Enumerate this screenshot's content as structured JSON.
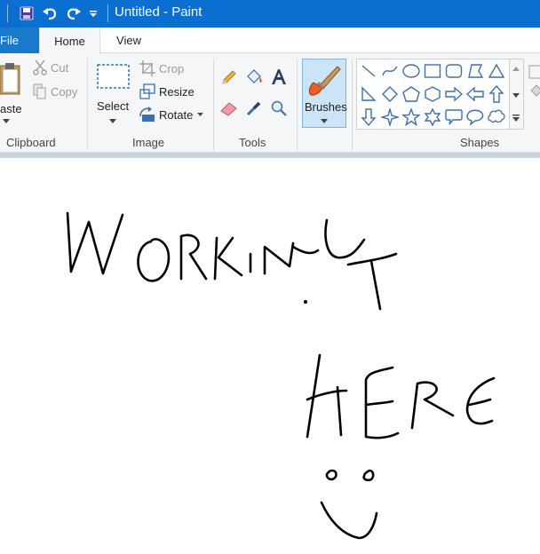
{
  "app": {
    "title": "Untitled - Paint",
    "accent_color": "#0a6fd1"
  },
  "quick_access": {
    "icons": [
      "save-icon",
      "undo-icon",
      "redo-icon",
      "customize-dropdown-icon"
    ]
  },
  "tabs": [
    {
      "label": "File"
    },
    {
      "label": "Home",
      "selected": true
    },
    {
      "label": "View"
    }
  ],
  "ribbon": {
    "clipboard": {
      "paste_label": "aste",
      "cut_label": "Cut",
      "copy_label": "Copy",
      "group_label": "Clipboard"
    },
    "image": {
      "select_label": "Select",
      "crop_label": "Crop",
      "resize_label": "Resize",
      "rotate_label": "Rotate",
      "group_label": "Image"
    },
    "tools": {
      "group_label": "Tools",
      "icons": [
        "pencil-icon",
        "fill-bucket-icon",
        "text-icon",
        "eraser-icon",
        "color-picker-icon",
        "magnifier-icon"
      ]
    },
    "brushes": {
      "label": "Brushes"
    },
    "shapes": {
      "group_label": "Shapes",
      "items": [
        "line",
        "curve",
        "oval",
        "rectangle",
        "rounded-rectangle",
        "polygon",
        "triangle",
        "right-triangle",
        "diamond",
        "pentagon",
        "hexagon",
        "right-arrow",
        "left-arrow",
        "up-arrow",
        "down-arrow",
        "four-point-star",
        "five-point-star",
        "six-point-star",
        "rounded-callout",
        "oval-callout",
        "cloud-callout"
      ]
    }
  },
  "canvas": {
    "background": "#ffffff",
    "ink_color": "#000000",
    "drawing_words": [
      "WORKING",
      "HERE"
    ]
  }
}
